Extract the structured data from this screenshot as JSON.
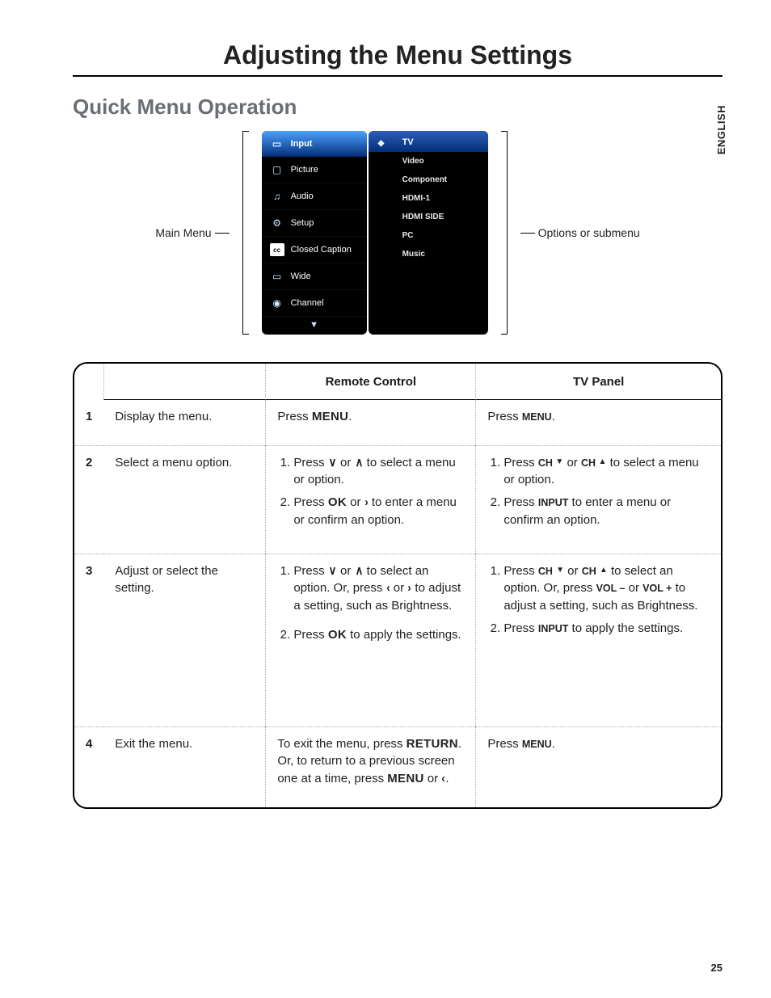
{
  "page": {
    "title": "Adjusting the Menu Settings",
    "section": "Quick Menu Operation",
    "language_tab": "ENGLISH",
    "page_number": "25"
  },
  "diagram": {
    "left_label": "Main Menu",
    "right_label": "Options or submenu",
    "main_menu": {
      "items": [
        {
          "icon": "input-icon",
          "label": "Input",
          "selected": true
        },
        {
          "icon": "picture-icon",
          "label": "Picture"
        },
        {
          "icon": "audio-icon",
          "label": "Audio"
        },
        {
          "icon": "setup-icon",
          "label": "Setup"
        },
        {
          "icon": "cc-icon",
          "label": "Closed Caption"
        },
        {
          "icon": "wide-icon",
          "label": "Wide"
        },
        {
          "icon": "channel-icon",
          "label": "Channel"
        }
      ],
      "arrow_down": "▼"
    },
    "submenu": {
      "badge": "TV",
      "selected": "TV",
      "items": [
        "Video",
        "Component",
        "HDMI-1",
        "HDMI SIDE",
        "PC",
        "Music"
      ]
    }
  },
  "table": {
    "headers": {
      "remote": "Remote Control",
      "panel": "TV Panel"
    },
    "rows": [
      {
        "num": "1",
        "desc": "Display the menu.",
        "remote_parts": [
          "Press ",
          "MENU",
          "."
        ],
        "panel_parts": [
          "Press ",
          "MENU",
          "."
        ]
      },
      {
        "num": "2",
        "desc": "Select a menu option.",
        "remote_list": [
          {
            "pre": "Press ",
            "mid": " or ",
            "post": " to select a menu or option.",
            "k1": "v",
            "k2": "^"
          },
          {
            "pre": "Press ",
            "k": "OK",
            "mid": " or ",
            "k2": ">",
            "post": " to enter a menu or confirm an option."
          }
        ],
        "panel_list": [
          {
            "pre": "Press ",
            "k": "CH ",
            "t1": "▼",
            "mid": " or ",
            "k2": "CH ",
            "t2": "▲",
            "post": " to select a menu or option."
          },
          {
            "pre": "Press ",
            "k": "INPUT",
            "post": " to enter a menu or confirm an option."
          }
        ]
      },
      {
        "num": "3",
        "desc": "Adjust or select the setting.",
        "remote_list": [
          {
            "text": "Press ∨ or ∧ to select an option. Or, press ‹ or › to adjust a setting, such as Brightness."
          },
          {
            "pre": "Press ",
            "k": "OK",
            "post": "  to apply the settings."
          }
        ],
        "panel_list": [
          {
            "text": "Press CH ▼ or CH ▲ to select an option. Or, press VOL – or VOL + to adjust a setting, such as Brightness."
          },
          {
            "pre": "Press ",
            "k": "INPUT",
            "post": "  to apply the settings."
          }
        ]
      },
      {
        "num": "4",
        "desc": "Exit the menu.",
        "remote_text": {
          "a": "To exit the menu, press ",
          "b": "RETURN",
          "c": ". Or, to return to a previous screen one at a time, press ",
          "d": "MENU",
          "e": " or ‹."
        },
        "panel_parts": [
          "Press ",
          "MENU",
          "."
        ]
      }
    ]
  }
}
